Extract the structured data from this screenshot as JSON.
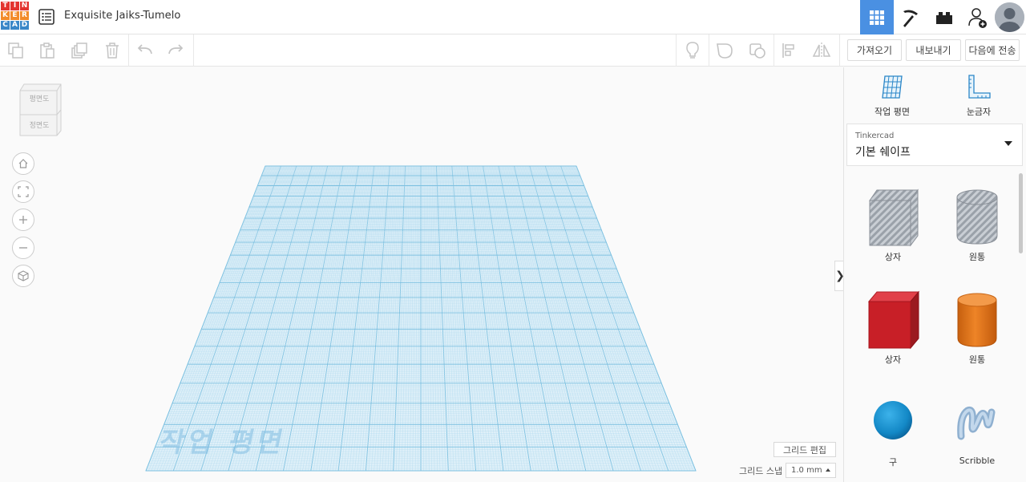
{
  "app": {
    "logo_letters": [
      "T",
      "I",
      "N",
      "K",
      "E",
      "R",
      "C",
      "A",
      "D"
    ],
    "logo_colors": [
      "#e3342f",
      "#e3342f",
      "#e3342f",
      "#f28b2a",
      "#f28b2a",
      "#f28b2a",
      "#3a87c8",
      "#3a87c8",
      "#3a87c8"
    ],
    "project_title": "Exquisite Jaiks-Tumelo"
  },
  "toolbar": {
    "import_label": "가져오기",
    "export_label": "내보내기",
    "send_to_label": "다음에 전송"
  },
  "viewcube": {
    "top_label": "평면도",
    "front_label": "정면도"
  },
  "workspace": {
    "workplane_watermark": "작업 평면",
    "grid_edit_label": "그리드 편집",
    "grid_snap_label": "그리드 스냅",
    "grid_snap_value": "1.0 mm"
  },
  "right_panel": {
    "workplane_tool_label": "작업 평면",
    "ruler_tool_label": "눈금자",
    "library_source": "Tinkercad",
    "library_name": "기본 쉐이프",
    "shapes": [
      {
        "label": "상자",
        "kind": "box-hole"
      },
      {
        "label": "원통",
        "kind": "cylinder-hole"
      },
      {
        "label": "상자",
        "kind": "box-red"
      },
      {
        "label": "원통",
        "kind": "cylinder-orange"
      },
      {
        "label": "구",
        "kind": "sphere-blue"
      },
      {
        "label": "Scribble",
        "kind": "scribble"
      }
    ]
  },
  "colors": {
    "accent": "#4a90e2",
    "grid": "#8fcbe6",
    "box_red": "#d0232c",
    "cylinder_orange": "#ea7a1d",
    "sphere_blue": "#1a8fcf"
  }
}
